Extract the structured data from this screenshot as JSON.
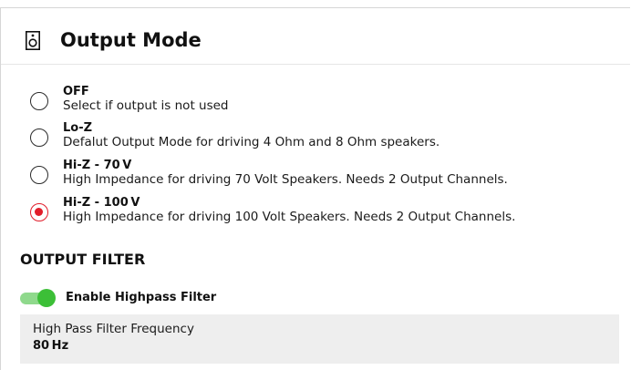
{
  "header": {
    "icon": "speaker-icon",
    "title": "Output Mode"
  },
  "output_modes": [
    {
      "title": "OFF",
      "description": "Select if output is not used",
      "selected": false
    },
    {
      "title": "Lo-Z",
      "description": "Defalut Output Mode for driving 4 Ohm and 8 Ohm speakers.",
      "selected": false
    },
    {
      "title": "Hi-Z - 70 V",
      "description": "High Impedance for driving 70 Volt Speakers. Needs 2 Output Channels.",
      "selected": false
    },
    {
      "title": "Hi-Z - 100 V",
      "description": "High Impedance for driving 100 Volt Speakers. Needs 2 Output Channels.",
      "selected": true
    }
  ],
  "output_filter": {
    "section_title": "OUTPUT FILTER",
    "highpass_toggle": {
      "label": "Enable Highpass Filter",
      "enabled": true
    },
    "frequency_field": {
      "label": "High Pass Filter Frequency",
      "value": "80 Hz"
    }
  },
  "colors": {
    "accent": "#e11d2a",
    "toggle_on": "#3cbf37",
    "toggle_track": "#8fd98c",
    "field_background": "#eeeeee"
  }
}
